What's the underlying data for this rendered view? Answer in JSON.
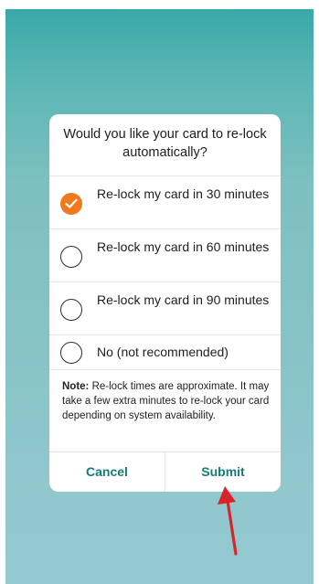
{
  "dialog": {
    "title": "Would you like your card to re-lock automatically?",
    "options": [
      {
        "label": "Re-lock my card in 30 minutes",
        "selected": true
      },
      {
        "label": "Re-lock my card in 60 minutes",
        "selected": false
      },
      {
        "label": "Re-lock my card in 90 minutes",
        "selected": false
      },
      {
        "label": "No (not recommended)",
        "selected": false
      }
    ],
    "note_label": "Note:",
    "note_text": " Re-lock times are approximate. It may take a few extra minutes to re-lock your card depending on system availability.",
    "cancel_label": "Cancel",
    "submit_label": "Submit"
  },
  "colors": {
    "accent": "#ef7a1d",
    "button_text": "#137c7a",
    "annotation_arrow": "#d8242a"
  }
}
